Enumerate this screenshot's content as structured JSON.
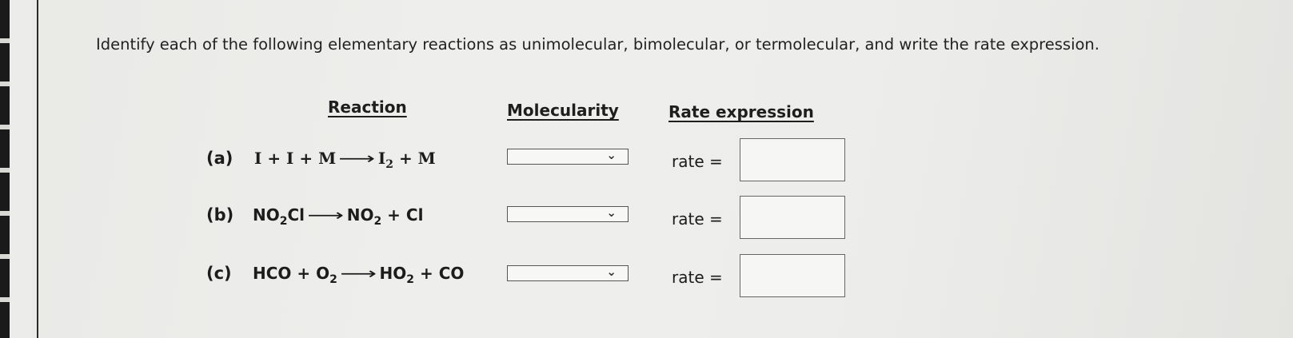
{
  "instructions": "Identify each of the following elementary reactions as unimolecular, bimolecular, or termolecular, and write the rate expression.",
  "headers": {
    "reaction": "Reaction",
    "molecularity": "Molecularity",
    "rate_expression": "Rate expression"
  },
  "rows": [
    {
      "letter": "(a)",
      "reactants": [
        {
          "text": "I + I + M"
        }
      ],
      "products": [
        {
          "text": "I"
        },
        {
          "sub": "2"
        },
        {
          "text": " + M"
        }
      ],
      "molecularity_value": "",
      "rate_label": "rate =",
      "rate_value": ""
    },
    {
      "letter": "(b)",
      "reactants": [
        {
          "text": "NO"
        },
        {
          "sub": "2"
        },
        {
          "text": "Cl"
        }
      ],
      "products": [
        {
          "text": "NO"
        },
        {
          "sub": "2"
        },
        {
          "text": " + Cl"
        }
      ],
      "molecularity_value": "",
      "rate_label": "rate =",
      "rate_value": ""
    },
    {
      "letter": "(c)",
      "reactants": [
        {
          "text": "HCO + O"
        },
        {
          "sub": "2"
        }
      ],
      "products": [
        {
          "text": "HO"
        },
        {
          "sub": "2"
        },
        {
          "text": " + CO"
        }
      ],
      "molecularity_value": "",
      "rate_label": "rate =",
      "rate_value": ""
    }
  ],
  "icons": {
    "reaction_arrow": "long-right-arrow-icon",
    "dropdown": "chevron-down-icon"
  }
}
